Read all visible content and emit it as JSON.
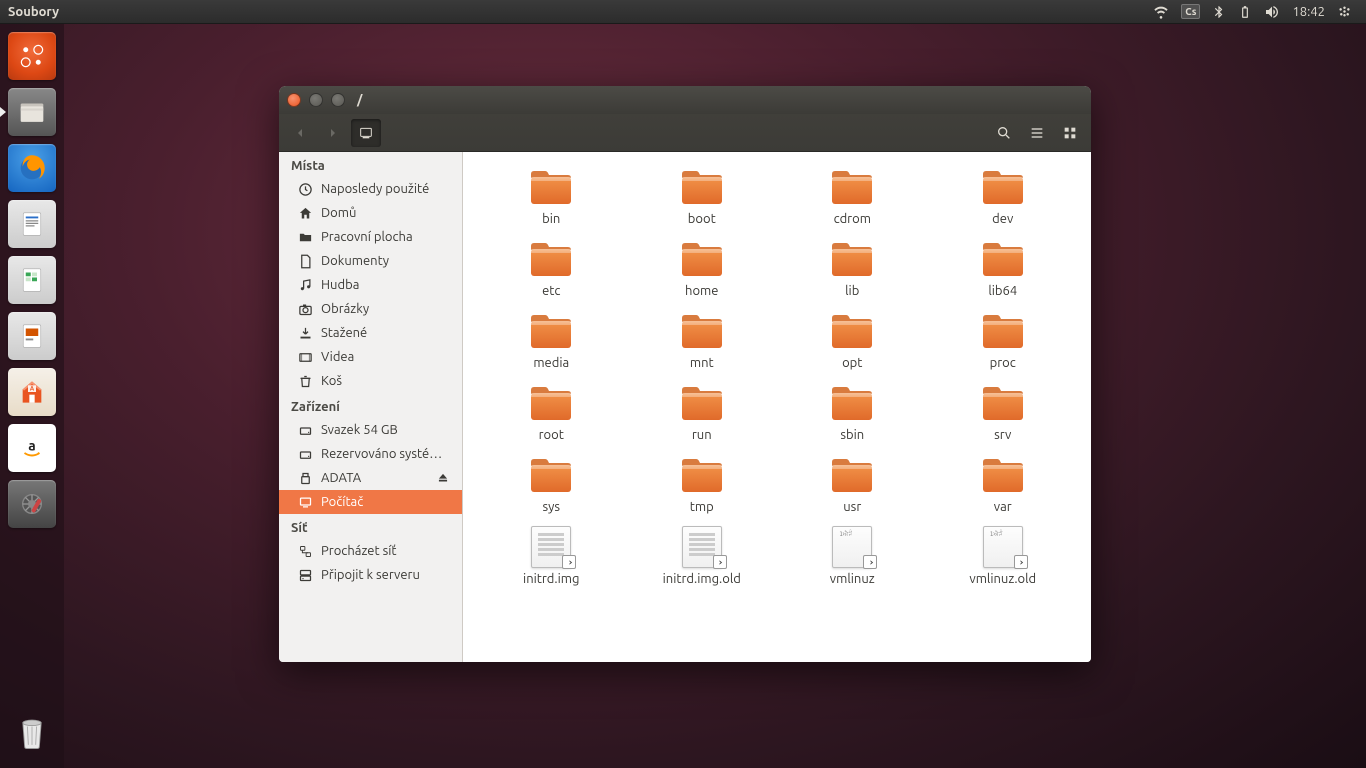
{
  "topbar": {
    "app_title": "Soubory",
    "keyboard_layout": "Cs",
    "time": "18:42"
  },
  "window": {
    "title": "/"
  },
  "sidebar": {
    "places_header": "Místa",
    "places": [
      {
        "icon": "clock",
        "label": "Naposledy použité"
      },
      {
        "icon": "home",
        "label": "Domů"
      },
      {
        "icon": "folder",
        "label": "Pracovní plocha"
      },
      {
        "icon": "doc",
        "label": "Dokumenty"
      },
      {
        "icon": "music",
        "label": "Hudba"
      },
      {
        "icon": "camera",
        "label": "Obrázky"
      },
      {
        "icon": "download",
        "label": "Stažené"
      },
      {
        "icon": "video",
        "label": "Videa"
      },
      {
        "icon": "trash",
        "label": "Koš"
      }
    ],
    "devices_header": "Zařízení",
    "devices": [
      {
        "icon": "drive",
        "label": "Svazek 54 GB",
        "eject": false
      },
      {
        "icon": "drive",
        "label": "Rezervováno systé…",
        "eject": false
      },
      {
        "icon": "usb",
        "label": "ADATA",
        "eject": true
      },
      {
        "icon": "computer",
        "label": "Počítač",
        "selected": true
      }
    ],
    "network_header": "Síť",
    "network": [
      {
        "icon": "network",
        "label": "Procházet síť"
      },
      {
        "icon": "server",
        "label": "Připojit k serveru"
      }
    ]
  },
  "files": [
    {
      "type": "folder",
      "name": "bin"
    },
    {
      "type": "folder",
      "name": "boot"
    },
    {
      "type": "folder",
      "name": "cdrom"
    },
    {
      "type": "folder",
      "name": "dev"
    },
    {
      "type": "folder",
      "name": "etc"
    },
    {
      "type": "folder",
      "name": "home"
    },
    {
      "type": "folder",
      "name": "lib"
    },
    {
      "type": "folder",
      "name": "lib64"
    },
    {
      "type": "folder",
      "name": "media"
    },
    {
      "type": "folder",
      "name": "mnt"
    },
    {
      "type": "folder",
      "name": "opt"
    },
    {
      "type": "folder",
      "name": "proc"
    },
    {
      "type": "folder",
      "name": "root"
    },
    {
      "type": "folder",
      "name": "run"
    },
    {
      "type": "folder",
      "name": "sbin"
    },
    {
      "type": "folder",
      "name": "srv"
    },
    {
      "type": "folder",
      "name": "sys"
    },
    {
      "type": "folder",
      "name": "tmp"
    },
    {
      "type": "folder",
      "name": "usr"
    },
    {
      "type": "folder",
      "name": "var"
    },
    {
      "type": "link",
      "name": "initrd.img"
    },
    {
      "type": "link",
      "name": "initrd.img.old"
    },
    {
      "type": "binlink",
      "name": "vmlinuz"
    },
    {
      "type": "binlink",
      "name": "vmlinuz.old"
    }
  ]
}
